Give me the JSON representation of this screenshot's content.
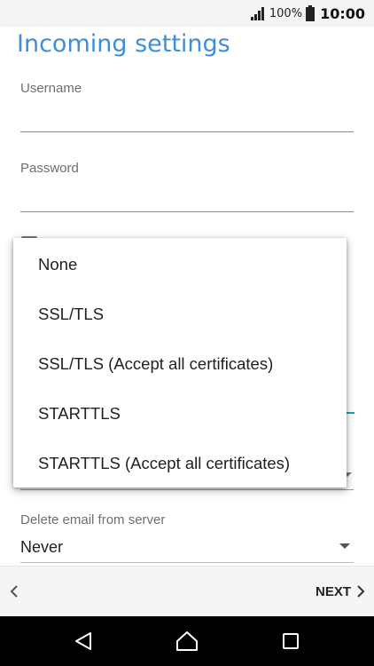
{
  "status_bar": {
    "battery_percent": "100%",
    "time": "10:00",
    "icons": [
      "signal-icon",
      "battery-icon"
    ]
  },
  "page": {
    "title": "Incoming settings"
  },
  "form": {
    "username_label": "Username",
    "username_value": "",
    "password_label": "Password",
    "password_value": "",
    "delete_label": "Delete email from server",
    "delete_value": "Never"
  },
  "popup_menu": {
    "options": [
      "None",
      "SSL/TLS",
      "SSL/TLS (Accept all certificates)",
      "STARTTLS",
      "STARTTLS (Accept all certificates)"
    ]
  },
  "wizard": {
    "next_label": "NEXT"
  },
  "colors": {
    "title": "#3f8fd8",
    "accent": "#16a2b8"
  }
}
